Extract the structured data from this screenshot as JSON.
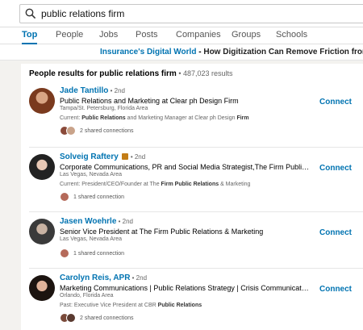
{
  "search": {
    "value": "public relations firm"
  },
  "tabs": [
    {
      "label": "Top",
      "active": true
    },
    {
      "label": "People"
    },
    {
      "label": "Jobs"
    },
    {
      "label": "Posts"
    },
    {
      "label": "Companies"
    },
    {
      "label": "Groups"
    },
    {
      "label": "Schools"
    }
  ],
  "banner": {
    "link": "Insurance's Digital World",
    "dash": " - ",
    "text": "How Digitization Can Remove Friction from the Insurance"
  },
  "results_header": {
    "title": "People results for public relations firm",
    "count": " • 487,023 results"
  },
  "people": [
    {
      "name": "Jade Tantillo",
      "degree": " • 2nd",
      "headline": "Public Relations and Marketing at Clear ph Design Firm",
      "location": "Tampa/St. Petersburg, Florida Area",
      "current_prefix": "Current: ",
      "current_bold1": "Public Relations",
      "current_mid": " and Marketing Manager at Clear ph Design ",
      "current_bold2": "Firm",
      "shared": "2 shared connections",
      "connect": "Connect"
    },
    {
      "name": "Solveig Raftery",
      "degree": " • 2nd",
      "headline": "Corporate Communications, PR and Social Media Strategist,The Firm Public Relation…",
      "location": "Las Vegas, Nevada Area",
      "current_prefix": "Current: President/CEO/Founder at The ",
      "current_bold1": "Firm Public Relations",
      "current_mid": " & Marketing",
      "current_bold2": "",
      "shared": "1 shared connection",
      "connect": "Connect"
    },
    {
      "name": "Jasen Woehrle",
      "degree": " • 2nd",
      "headline": "Senior Vice President at The Firm Public Relations & Marketing",
      "location": "Las Vegas, Nevada Area",
      "shared": "1 shared connection",
      "connect": "Connect"
    },
    {
      "name": "Carolyn Reis, APR",
      "degree": " • 2nd",
      "headline": "Marketing Communications | Public Relations Strategy | Crisis Communications | Con…",
      "location": "Orlando, Florida Area",
      "current_prefix": "Past: Executive Vice President at CBR ",
      "current_bold1": "Public Relations",
      "current_mid": "",
      "current_bold2": "",
      "shared": "2 shared connections",
      "connect": "Connect"
    }
  ],
  "colors": {
    "accent": "#0073b1",
    "background": "#f3f2ef",
    "linkedin_badge": "#c37d16"
  },
  "icons": {
    "search": "search-icon",
    "badge": "linkedin-premium-icon"
  }
}
